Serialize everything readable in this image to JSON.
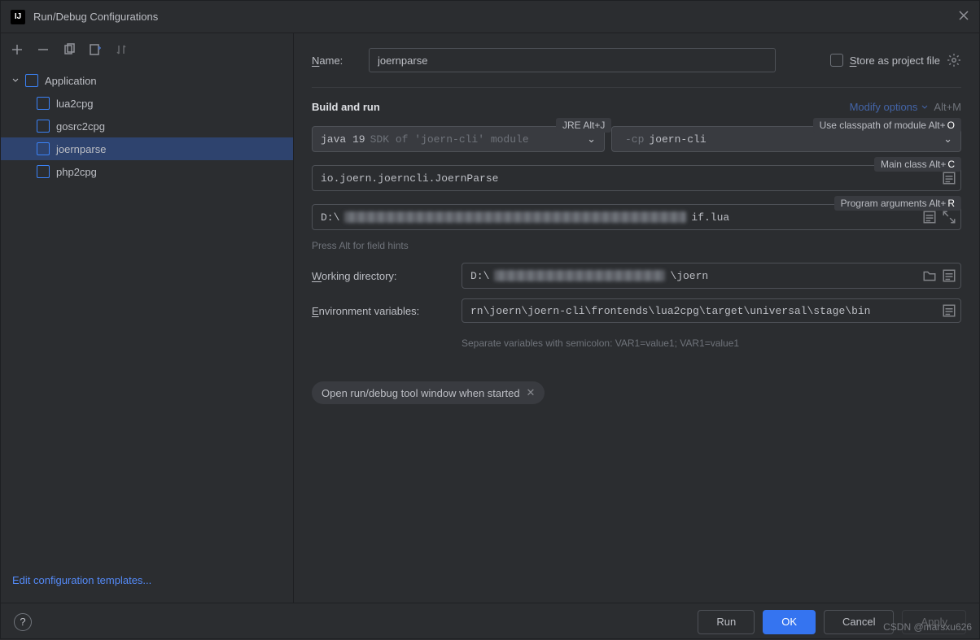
{
  "window": {
    "title": "Run/Debug Configurations"
  },
  "tree": {
    "group": "Application",
    "items": [
      "lua2cpg",
      "gosrc2cpg",
      "joernparse",
      "php2cpg"
    ],
    "selected_index": 2
  },
  "sidebar": {
    "edit_templates": "Edit configuration templates..."
  },
  "form": {
    "name_label": "Name:",
    "name_value": "joernparse",
    "store_label": "Store as project file",
    "build_run": "Build and run",
    "modify_options": "Modify options",
    "modify_kbd": "Alt+M",
    "jre_hint": "JRE Alt+J",
    "classpath_hint": "Use classpath of module Alt+",
    "classpath_hint_key": "O",
    "sdk_value": "java 19",
    "sdk_dim": "SDK of 'joern-cli' module",
    "cp_prefix": "-cp",
    "cp_value": "joern-cli",
    "main_class_hint": "Main class Alt+",
    "main_class_hint_key": "C",
    "main_class_value": "io.joern.joerncli.JoernParse",
    "args_hint": "Program arguments Alt+",
    "args_hint_key": "R",
    "args_prefix": "D:\\",
    "args_suffix": "if.lua",
    "alt_hint_text": "Press Alt for field hints",
    "wd_label": "Working directory:",
    "wd_prefix": "D:\\",
    "wd_suffix": "\\joern",
    "env_label": "Environment variables:",
    "env_value": "rn\\joern\\joern-cli\\frontends\\lua2cpg\\target\\universal\\stage\\bin",
    "env_help": "Separate variables with semicolon: VAR1=value1; VAR1=value1",
    "chip_text": "Open run/debug tool window when started"
  },
  "footer": {
    "run": "Run",
    "ok": "OK",
    "cancel": "Cancel",
    "apply": "Apply"
  },
  "watermark": "CSDN @marsxu626"
}
